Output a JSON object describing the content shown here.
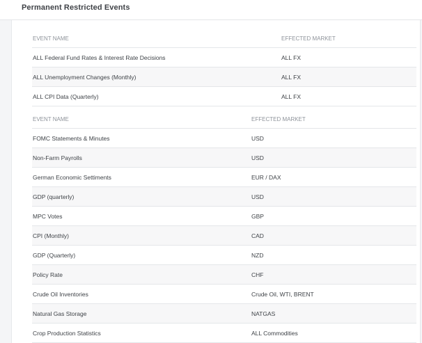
{
  "title": "Permanent Restricted Events",
  "table1": {
    "headers": [
      "EVENT NAME",
      "EFFECTED MARKET"
    ],
    "rows": [
      {
        "event": "ALL Federal Fund Rates & Interest Rate Decisions",
        "market": "ALL FX"
      },
      {
        "event": "ALL Unemployment Changes (Monthly)",
        "market": "ALL FX"
      },
      {
        "event": "ALL CPI Data (Quarterly)",
        "market": "ALL FX"
      }
    ]
  },
  "table2": {
    "headers": [
      "EVENT NAME",
      "EFFECTED MARKET"
    ],
    "rows": [
      {
        "event": "FOMC Statements & Minutes",
        "market": "USD"
      },
      {
        "event": "Non-Farm Payrolls",
        "market": "USD"
      },
      {
        "event": "German Economic Settiments",
        "market": "EUR / DAX"
      },
      {
        "event": "GDP (quarterly)",
        "market": "USD"
      },
      {
        "event": "MPC Votes",
        "market": "GBP"
      },
      {
        "event": "CPI (Monthly)",
        "market": "CAD"
      },
      {
        "event": "GDP (Quarterly)",
        "market": "NZD"
      },
      {
        "event": "Policy Rate",
        "market": "CHF"
      },
      {
        "event": "Crude Oil Inventories",
        "market": "Crude Oil, WTI, BRENT"
      },
      {
        "event": "Natural Gas Storage",
        "market": "NATGAS"
      },
      {
        "event": "Crop Production Statistics",
        "market": "ALL Commodities"
      }
    ]
  }
}
